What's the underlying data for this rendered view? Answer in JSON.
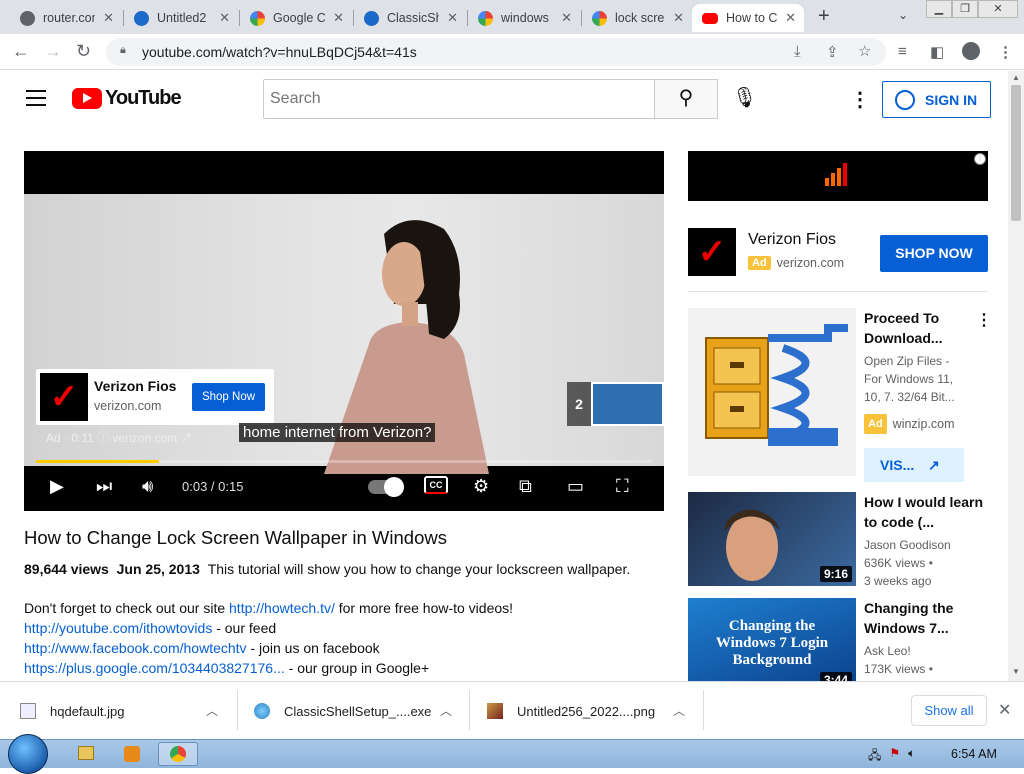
{
  "browser": {
    "tabs": [
      {
        "title": "router.com",
        "favicon": "globe-icon"
      },
      {
        "title": "Untitled2",
        "favicon": "classicshell-icon"
      },
      {
        "title": "Google C",
        "favicon": "google-icon"
      },
      {
        "title": "ClassicSh",
        "favicon": "classicshell-icon"
      },
      {
        "title": "windows",
        "favicon": "google-icon"
      },
      {
        "title": "lock scre",
        "favicon": "google-icon"
      },
      {
        "title": "How to C",
        "favicon": "youtube-icon",
        "active": true
      }
    ],
    "url": "youtube.com/watch?v=hnuLBqDCj54&t=41s"
  },
  "youtube": {
    "logo_text": "YouTube",
    "search_placeholder": "Search",
    "sign_in": "SIGN IN"
  },
  "player": {
    "ad_card": {
      "name": "Verizon Fios",
      "domain": "verizon.com",
      "button": "Shop Now"
    },
    "ad_meta": "Ad · 0:11  ⓘ  verizon.com ↗",
    "caption": "home internet from Verizon?",
    "next_count": "2",
    "time": "0:03 / 0:15",
    "cc_label": "CC",
    "progress": 0.2
  },
  "video": {
    "title": "How to Change Lock Screen Wallpaper in Windows",
    "views": "89,644 views",
    "date": "Jun 25, 2013",
    "summary": "This tutorial will show you how to change your lockscreen wallpaper.",
    "desc": [
      {
        "pre": "Don't forget to check out our site ",
        "link": "http://howtech.tv/",
        "post": " for more free how-to videos!"
      },
      {
        "pre": "",
        "link": "http://youtube.com/ithowtovids",
        "post": " - our feed"
      },
      {
        "pre": "",
        "link": "http://www.facebook.com/howtechtv",
        "post": " - join us on facebook"
      },
      {
        "pre": "",
        "link": "https://plus.google.com/1034403827176...",
        "post": " - our group in Google+"
      }
    ]
  },
  "sidebar": {
    "ad": {
      "name": "Verizon Fios",
      "badge": "Ad",
      "domain": "verizon.com",
      "button": "SHOP NOW"
    },
    "recs": [
      {
        "title": "Proceed To Download...",
        "lines": [
          "Open Zip Files -",
          "For Windows 11,",
          "10, 7. 32/64 Bit..."
        ],
        "badge": "Ad",
        "domain": "winzip.com",
        "button": "VIS..."
      },
      {
        "title": "How I would learn to code (...",
        "channel": "Jason Goodison",
        "views": "636K views •",
        "age": "3 weeks ago",
        "duration": "9:16"
      },
      {
        "title": "Changing the Windows 7...",
        "channel": "Ask Leo!",
        "views": "173K views •",
        "duration": "3:44",
        "thumb_text": [
          "Changing the",
          "Windows 7 Login",
          "Background"
        ]
      }
    ]
  },
  "downloads": {
    "items": [
      {
        "name": "hqdefault.jpg"
      },
      {
        "name": "ClassicShellSetup_....exe"
      },
      {
        "name": "Untitled256_2022....png"
      }
    ],
    "show_all": "Show all"
  },
  "taskbar": {
    "clock": "6:54 AM"
  }
}
